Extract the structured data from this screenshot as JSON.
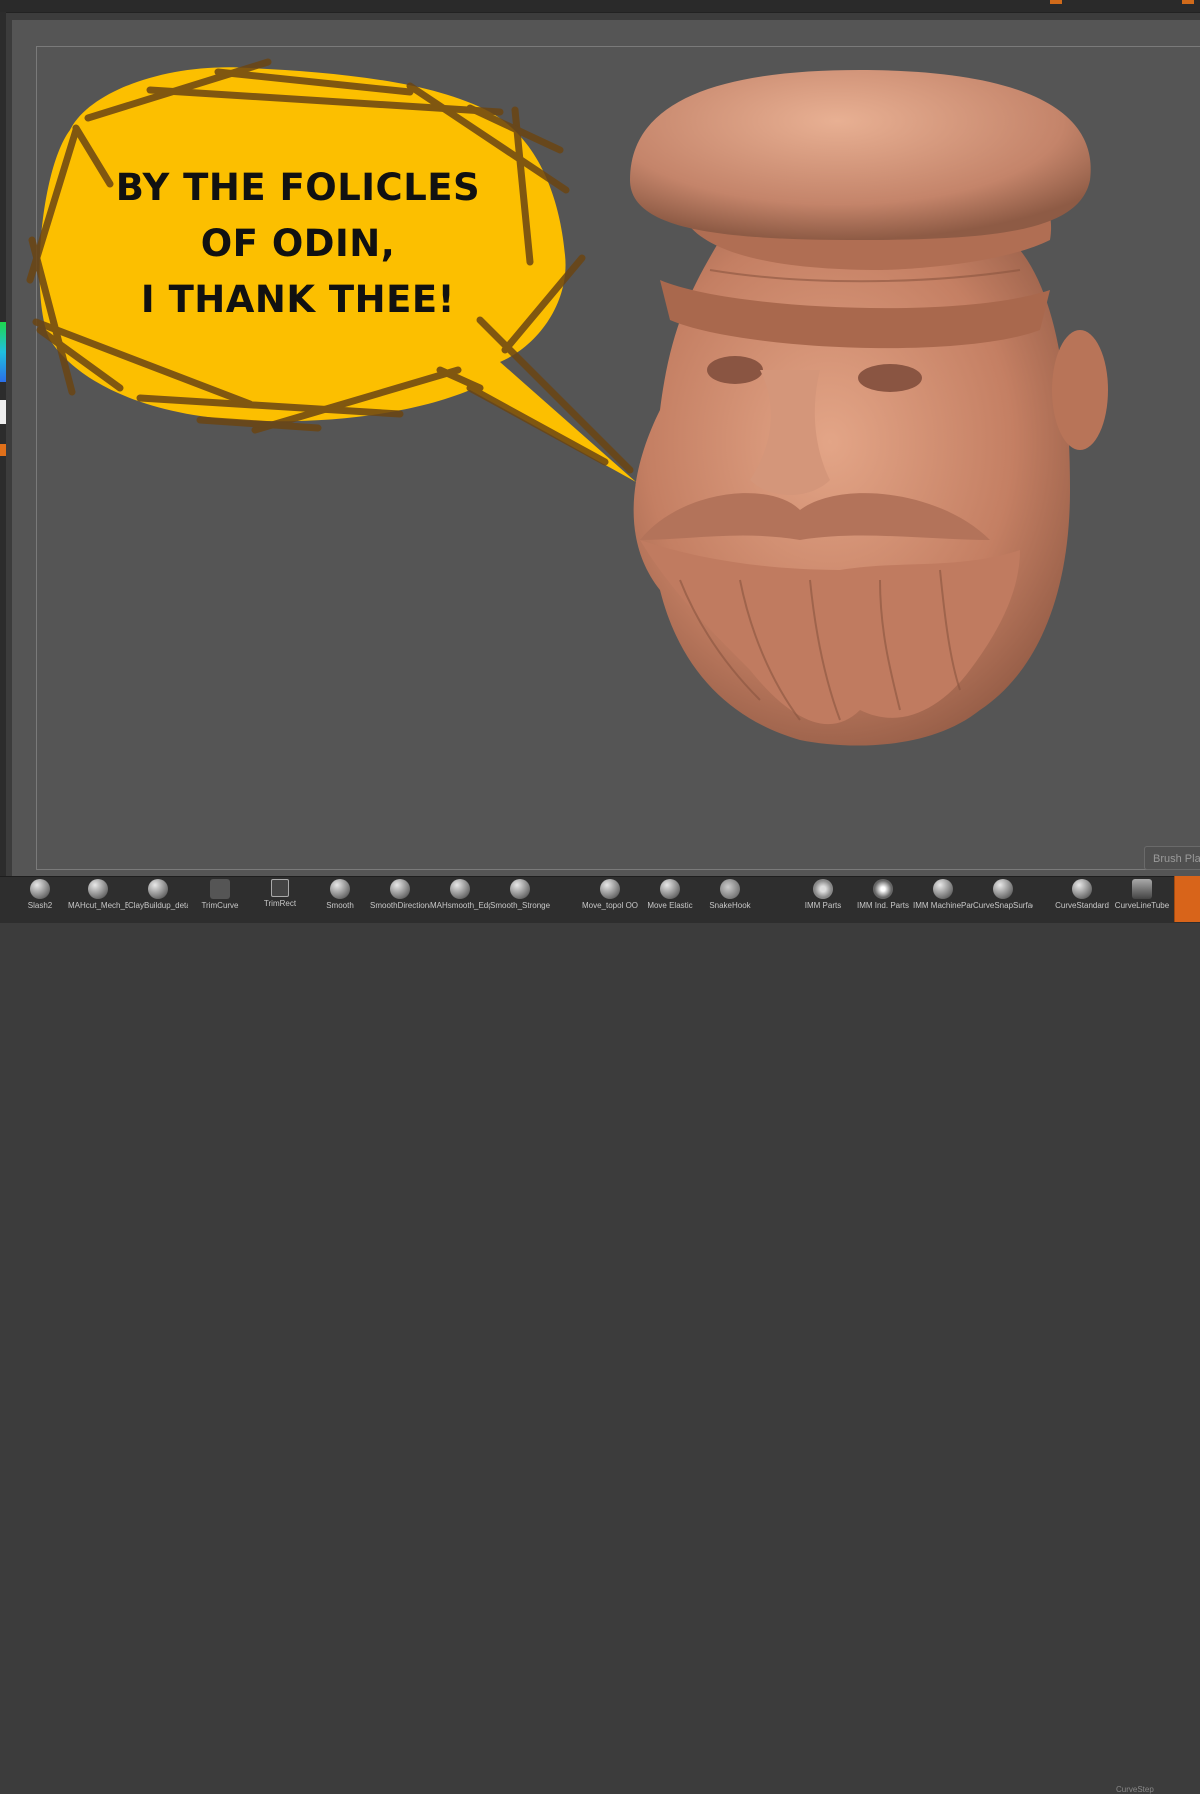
{
  "speech_bubble": {
    "lines": [
      "BY THE FOLICLES",
      "OF ODIN,",
      "I THANK THEE!"
    ],
    "fill_color": "#fcbf00",
    "stroke_color": "#6b4513"
  },
  "viewport": {
    "background_color": "#555555",
    "model_color": "#c47f63"
  },
  "brush_plate": {
    "label": "Brush Pla"
  },
  "accent_color": "#d8641a",
  "brush_shelf": {
    "brushes": [
      {
        "label": "Slash2",
        "icon": "sphere-icon"
      },
      {
        "label": "MAHcut_Mech_B",
        "icon": "sphere-icon"
      },
      {
        "label": "ClayBuildup_detai",
        "icon": "sphere-icon"
      },
      {
        "label": "TrimCurve",
        "icon": "curve-icon"
      },
      {
        "label": "TrimRect",
        "icon": "rect-icon"
      },
      {
        "label": "Smooth",
        "icon": "sphere-icon"
      },
      {
        "label": "SmoothDirectiona",
        "icon": "sphere-icon"
      },
      {
        "label": "MAHsmooth_Edge",
        "icon": "sphere-icon"
      },
      {
        "label": "Smooth_Stronger",
        "icon": "sphere-icon"
      },
      {
        "label": "Move_topol OO",
        "icon": "sphere-icon"
      },
      {
        "label": "Move Elastic",
        "icon": "sphere-icon"
      },
      {
        "label": "SnakeHook",
        "icon": "hook-icon"
      },
      {
        "label": "IMM Parts",
        "icon": "parts-icon"
      },
      {
        "label": "IMM Ind. Parts",
        "icon": "parts-icon"
      },
      {
        "label": "IMM MachinePar!",
        "icon": "sphere-icon"
      },
      {
        "label": "CurveSnapSurfac",
        "icon": "sphere-icon"
      },
      {
        "label": "CurveStandard",
        "icon": "sphere-icon"
      },
      {
        "label": "CurveLineTube",
        "icon": "tube-icon"
      }
    ],
    "sub_label": "CurveStep"
  }
}
